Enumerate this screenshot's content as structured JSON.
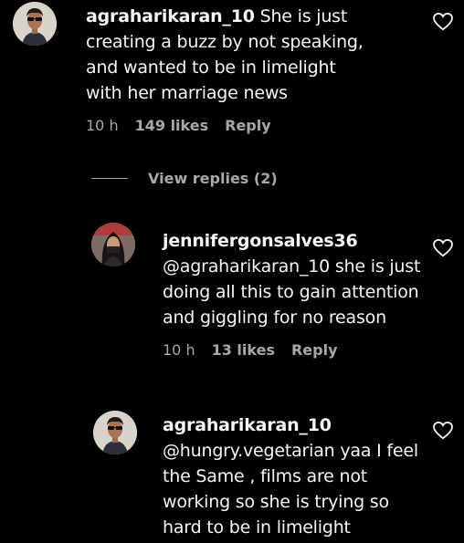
{
  "comments": [
    {
      "username": "agraharikaran_10",
      "text": "She is just creating a buzz by not speaking, and wanted to be in limelight with her marriage news",
      "time": "10 h",
      "likes": "149 likes",
      "reply": "Reply",
      "avatar_icon": "avatar-man-glasses"
    }
  ],
  "view_replies": "View replies (2)",
  "replies": [
    {
      "username": "jennifergonsalves36",
      "mention": "@agraharikaran_10",
      "text": " she is just doing all this to gain attention and giggling for no reason",
      "time": "10 h",
      "likes": "13 likes",
      "reply": "Reply",
      "avatar_icon": "avatar-woman"
    },
    {
      "username": "agraharikaran_10",
      "mention": "@hungry.vegetarian",
      "text": " yaa I feel the Same , films are not working so she is trying so hard to be in limelight",
      "avatar_icon": "avatar-man-glasses"
    }
  ],
  "colors": {
    "background": "#000000",
    "text": "#f5f5f5",
    "muted": "#a8a8a8"
  },
  "icons": {
    "like": "heart-outline-icon"
  }
}
